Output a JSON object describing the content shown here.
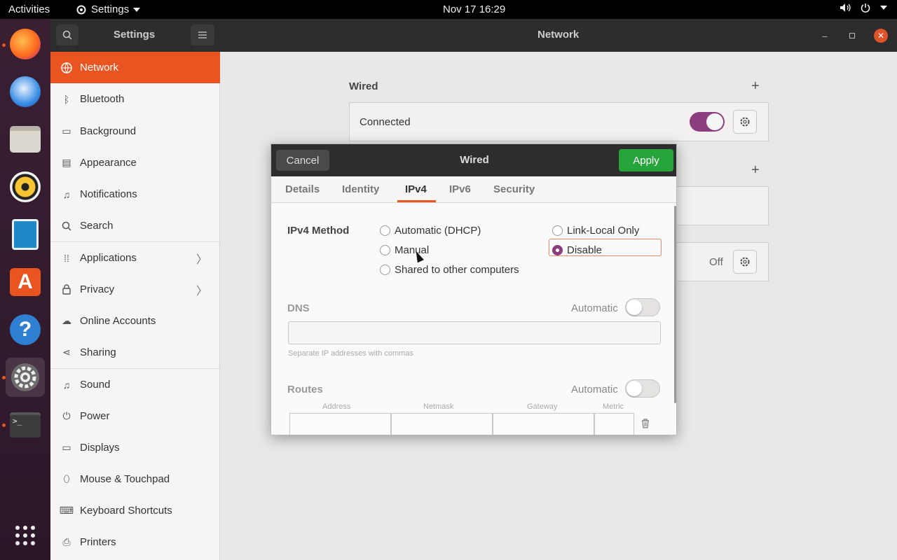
{
  "topbar": {
    "activities": "Activities",
    "app_menu": "Settings",
    "clock": "Nov 17  16:29"
  },
  "dock": {
    "items": [
      "firefox-icon",
      "thunderbird-icon",
      "files-icon",
      "rhythmbox-icon",
      "libreoffice-writer-icon",
      "software-icon",
      "help-icon",
      "settings-icon",
      "terminal-icon",
      "show-apps-icon"
    ]
  },
  "headerbar": {
    "left_title": "Settings",
    "title": "Network"
  },
  "sidebar": {
    "items": [
      {
        "label": "Network",
        "icon": "network-icon"
      },
      {
        "label": "Bluetooth",
        "icon": "bluetooth-icon"
      },
      {
        "label": "Background",
        "icon": "background-icon"
      },
      {
        "label": "Appearance",
        "icon": "appearance-icon"
      },
      {
        "label": "Notifications",
        "icon": "bell-icon"
      },
      {
        "label": "Search",
        "icon": "search-icon"
      },
      {
        "label": "Applications",
        "icon": "apps-grid-icon"
      },
      {
        "label": "Privacy",
        "icon": "lock-icon"
      },
      {
        "label": "Online Accounts",
        "icon": "cloud-icon"
      },
      {
        "label": "Sharing",
        "icon": "share-icon"
      },
      {
        "label": "Sound",
        "icon": "music-note-icon"
      },
      {
        "label": "Power",
        "icon": "power-icon"
      },
      {
        "label": "Displays",
        "icon": "display-icon"
      },
      {
        "label": "Mouse & Touchpad",
        "icon": "mouse-icon"
      },
      {
        "label": "Keyboard Shortcuts",
        "icon": "keyboard-icon"
      },
      {
        "label": "Printers",
        "icon": "printer-icon"
      }
    ]
  },
  "content": {
    "wired_label": "Wired",
    "connected_label": "Connected",
    "off_label": "Off"
  },
  "dialog": {
    "cancel": "Cancel",
    "title": "Wired",
    "apply": "Apply",
    "tabs": [
      "Details",
      "Identity",
      "IPv4",
      "IPv6",
      "Security"
    ],
    "active_tab": "IPv4",
    "method_label": "IPv4 Method",
    "methods": {
      "automatic": "Automatic (DHCP)",
      "link_local": "Link-Local Only",
      "manual": "Manual",
      "disable": "Disable",
      "shared": "Shared to other computers"
    },
    "selected_method": "Disable",
    "dns_label": "DNS",
    "automatic_label": "Automatic",
    "dns_value": "",
    "dns_hint": "Separate IP addresses with commas",
    "routes_label": "Routes",
    "route_columns": [
      "Address",
      "Netmask",
      "Gateway",
      "Metric"
    ]
  },
  "colors": {
    "accent": "#e95420",
    "toggle_on": "#8c3d7f",
    "apply": "#26a53a"
  }
}
